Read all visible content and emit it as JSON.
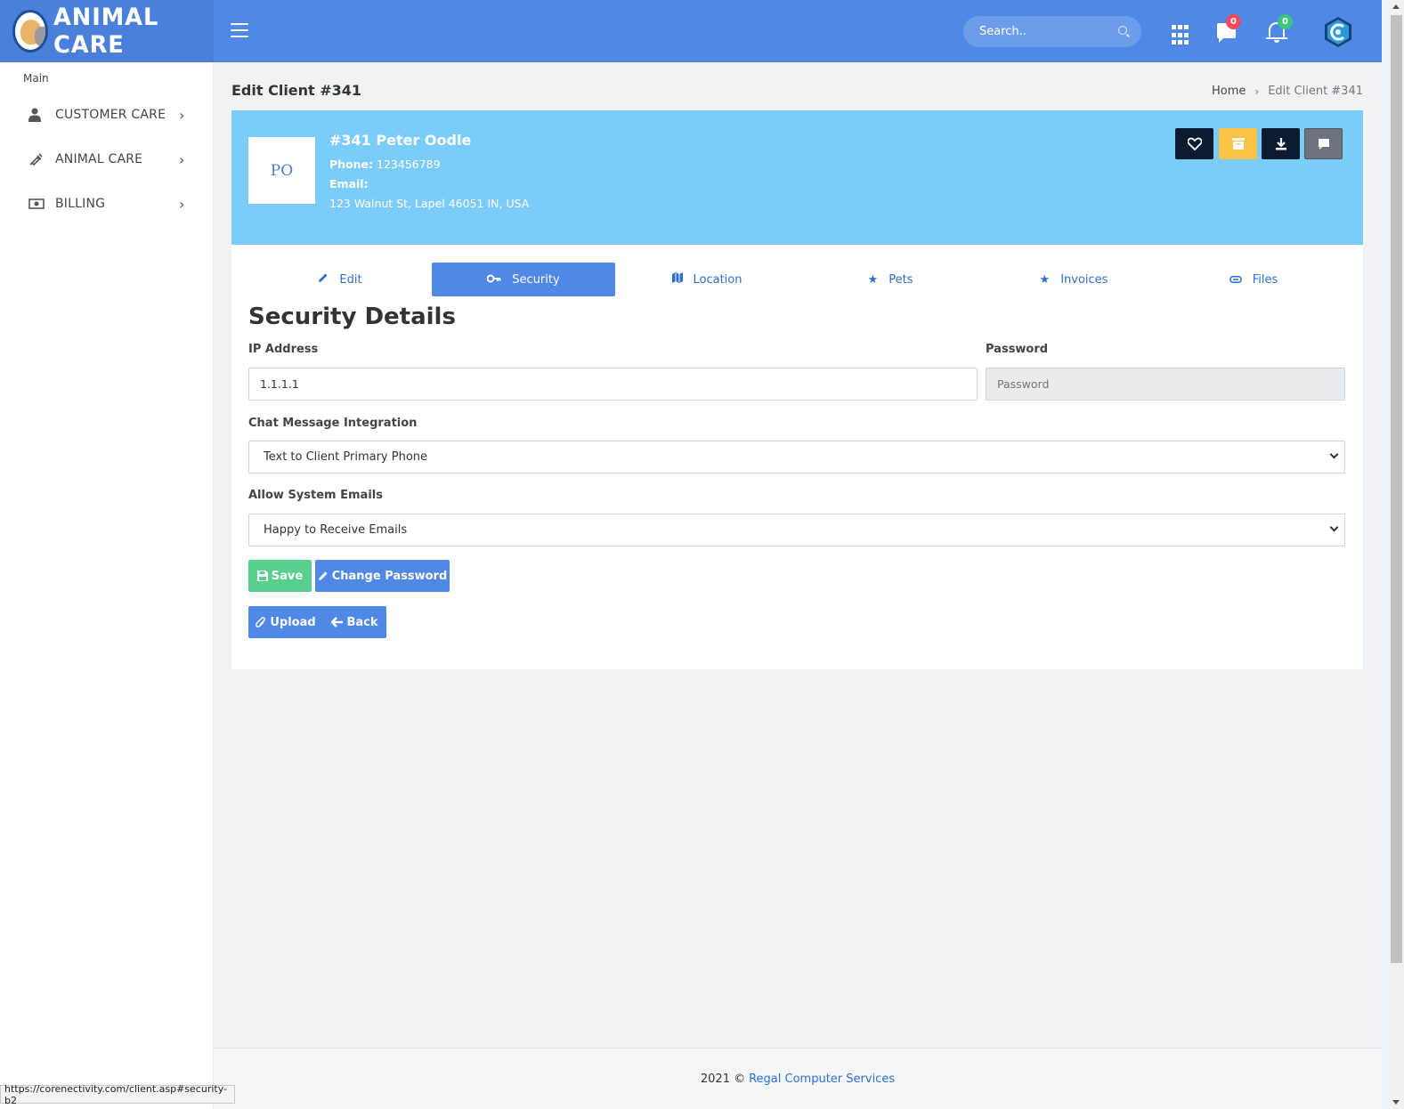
{
  "brand": {
    "name": "ANIMAL CARE"
  },
  "topbar": {
    "search_placeholder": "Search..",
    "messages_count": "0",
    "notifications_count": "0"
  },
  "sidebar": {
    "section": "Main",
    "items": [
      {
        "label": "CUSTOMER CARE",
        "icon": "user-icon"
      },
      {
        "label": "ANIMAL CARE",
        "icon": "syringe-icon"
      },
      {
        "label": "BILLING",
        "icon": "money-icon"
      }
    ]
  },
  "page": {
    "title": "Edit Client #341",
    "breadcrumb": {
      "home": "Home",
      "current": "Edit Client #341"
    }
  },
  "client": {
    "initials": "PO",
    "name": "#341 Peter Oodle",
    "phone_label": "Phone:",
    "phone": "123456789",
    "email_label": "Email:",
    "email": "",
    "address": "123 Walnut St, Lapel 46051 IN, USA"
  },
  "tabs": [
    {
      "label": "Edit",
      "icon": "pencil-icon"
    },
    {
      "label": "Security",
      "icon": "key-icon"
    },
    {
      "label": "Location",
      "icon": "map-icon"
    },
    {
      "label": "Pets",
      "icon": "star-icon"
    },
    {
      "label": "Invoices",
      "icon": "star-icon"
    },
    {
      "label": "Files",
      "icon": "paperclip-icon"
    }
  ],
  "active_tab": "Security",
  "form": {
    "title": "Security Details",
    "ip_label": "IP Address",
    "ip_value": "1.1.1.1",
    "password_label": "Password",
    "password_placeholder": "Password",
    "chat_label": "Chat Message Integration",
    "chat_value": "Text to Client Primary Phone",
    "emails_label": "Allow System Emails",
    "emails_value": "Happy to Receive Emails"
  },
  "buttons": {
    "save": "Save",
    "change_password": "Change Password",
    "upload": "Upload",
    "back": "Back"
  },
  "footer": {
    "year": "2021 ©",
    "company": "Regal Computer Services"
  },
  "status_url": "https://corenectivity.com/client.asp#security-b2",
  "colors": {
    "primary": "#5088e8",
    "banner": "#7bcbfb",
    "success": "#58cf8c",
    "warning": "#fdc248",
    "dark": "#0e1a30"
  }
}
